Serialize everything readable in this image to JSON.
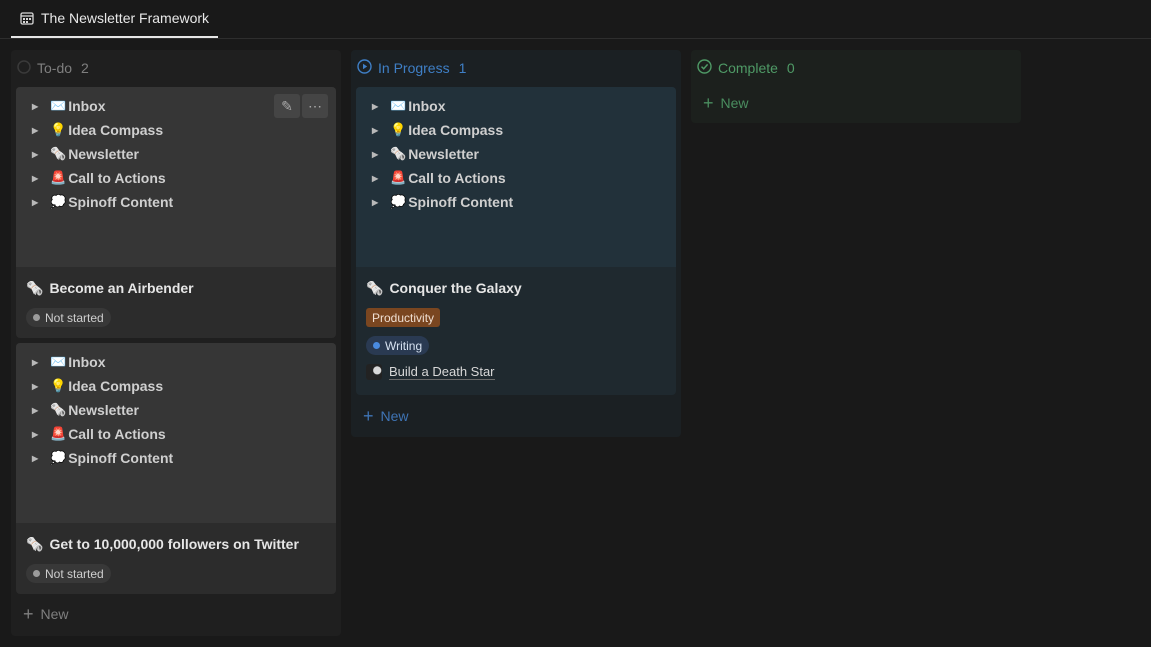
{
  "tab": {
    "title": "The Newsletter Framework",
    "icon": "calendar-icon"
  },
  "toggles": [
    {
      "emoji": "✉️",
      "label": "Inbox"
    },
    {
      "emoji": "💡",
      "label": "Idea Compass"
    },
    {
      "emoji": "🗞️",
      "label": "Newsletter"
    },
    {
      "emoji": "🚨",
      "label": "Call to Actions"
    },
    {
      "emoji": "💭",
      "label": "Spinoff Content"
    }
  ],
  "columns": {
    "todo": {
      "title": "To-do",
      "count": "2",
      "color": "#7f7f7f",
      "cards": [
        {
          "emoji": "🗞️",
          "title": "Become an Airbender",
          "status": "Not started"
        },
        {
          "emoji": "🗞️",
          "title": "Get to 10,000,000 followers on Twitter",
          "status": "Not started"
        }
      ],
      "new_label": "New"
    },
    "progress": {
      "title": "In Progress",
      "count": "1",
      "color": "#3f7fc6",
      "cards": [
        {
          "emoji": "🗞️",
          "title": "Conquer the Galaxy",
          "tag": "Productivity",
          "status": "Writing",
          "relation": "Build a Death Star"
        }
      ],
      "new_label": "New"
    },
    "complete": {
      "title": "Complete",
      "count": "0",
      "color": "#4f9a66",
      "new_label": "New"
    }
  }
}
